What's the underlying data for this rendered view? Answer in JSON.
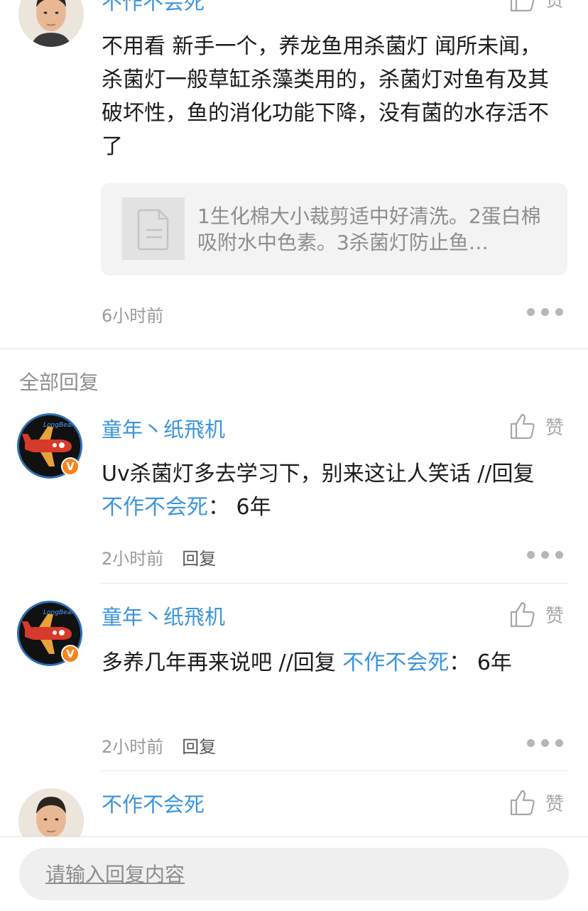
{
  "top_comment": {
    "username": "不作不会死",
    "like_label": "赞",
    "content": "不用看 新手一个，养龙鱼用杀菌灯 闻所未闻，杀菌灯一般草缸杀藻类用的，杀菌灯对鱼有及其破坏性，鱼的消化功能下降，没有菌的水存活不了",
    "quote_text": "1生化棉大小裁剪适中好清洗。2蛋白棉吸附水中色素。3杀菌灯防止鱼…",
    "time": "6小时前"
  },
  "section_title": "全部回复",
  "replies": [
    {
      "username": "童年丶纸飛机",
      "like_label": "赞",
      "text": "Uv杀菌灯多去学习下，别来这让人笑话 //回复 ",
      "mention": "不作不会死",
      "after": "： 6年",
      "time": "2小时前",
      "reply_label": "回复",
      "badge": "V"
    },
    {
      "username": "童年丶纸飛机",
      "like_label": "赞",
      "text": "多养几年再来说吧 //回复 ",
      "mention": "不作不会死",
      "after": "： 6年",
      "time": "2小时前",
      "reply_label": "回复",
      "badge": "V"
    },
    {
      "username": "不作不会死",
      "like_label": "赞"
    }
  ],
  "bottom_bar": {
    "placeholder": "请输入回复内容"
  },
  "avatar_logo_text": "LongBear",
  "colors": {
    "link": "#3b94dc",
    "badge": "#f5841f",
    "muted": "#9a9a9a"
  }
}
